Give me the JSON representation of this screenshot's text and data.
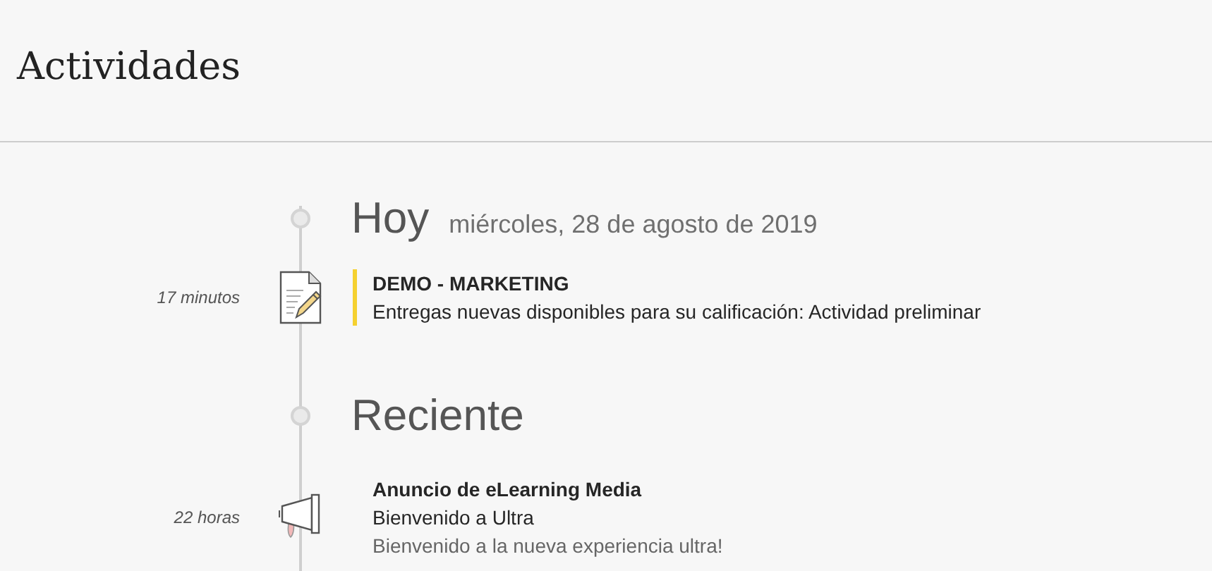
{
  "page_title": "Actividades",
  "sections": [
    {
      "heading": "Hoy",
      "date": "miércoles, 28 de agosto de 2019",
      "items": [
        {
          "kind": "assignment",
          "time": "17 minutos",
          "highlighted": true,
          "title": "DEMO - MARKETING",
          "lines": [
            "Entregas nuevas disponibles para su calificación: Actividad preliminar"
          ]
        }
      ]
    },
    {
      "heading": "Reciente",
      "items": [
        {
          "kind": "announcement",
          "time": "22 horas",
          "highlighted": false,
          "title": "Anuncio de eLearning Media",
          "lines": [
            "Bienvenido a Ultra",
            "Bienvenido a la nueva experiencia ultra!"
          ]
        }
      ]
    }
  ]
}
